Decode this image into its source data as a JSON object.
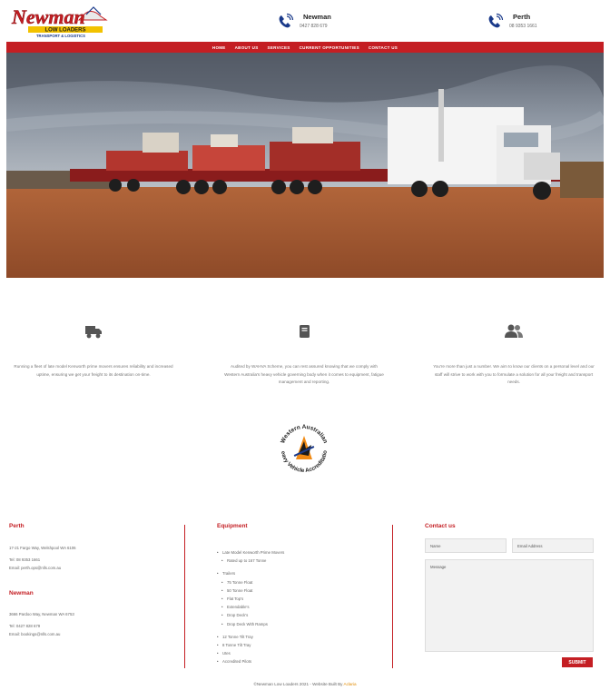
{
  "header": {
    "logo_text": "Newman",
    "logo_subtext": "LOW LOADERS",
    "logo_tagline": "TRANSPORT & LOGISTICS",
    "contacts": [
      {
        "name": "Newman",
        "phone": "0427 828 679"
      },
      {
        "name": "Perth",
        "phone": "08 9353 1661"
      }
    ]
  },
  "nav": {
    "items": [
      "HOME",
      "ABOUT US",
      "SERVICES",
      "CURRENT OPPORTUNITIES",
      "CONTACT US"
    ]
  },
  "features": [
    {
      "icon": "truck-icon",
      "text": "Running a fleet of late model Kenworth prime movers ensures reliability and increased uptime, ensuring we get your freight to its destination on-time."
    },
    {
      "icon": "book-icon",
      "text": "Audited by WAHVA Scheme, you can rest assured knowing that we comply with Western Australia's heavy vehicle governing body when it comes to equipment, fatigue management and reporting."
    },
    {
      "icon": "users-icon",
      "text": "You're more than just a number. We aim to know our clients on a personal level and our staff will strive to work with you to formulate a solution for all your freight and transport needs."
    }
  ],
  "accreditation": {
    "top_text": "Western Australian",
    "bottom_text": "Heavy Vehicle Accreditation"
  },
  "footer": {
    "perth": {
      "title": "Perth",
      "address": "17-21 Fargo Way, Welshpool WA 6106",
      "tel": "Tel: 08 9353 1661",
      "email": "Email: perth.ops@nlls.com.au"
    },
    "newman": {
      "title": "Newman",
      "address": "3666 Pardoo Way, Newman WA 6753",
      "tel": "Tel: 0427 828 679",
      "email": "Email: bookings@nlls.com.au"
    },
    "equipment": {
      "title": "Equipment",
      "items": [
        {
          "label": "Late Model Kenworth Prime Movers",
          "level": 0,
          "gap": false
        },
        {
          "label": "Rated up to 167 Tonne",
          "level": 1,
          "gap": false
        },
        {
          "label": "Trailers",
          "level": 0,
          "gap": true
        },
        {
          "label": "75 Tonne Float",
          "level": 1,
          "gap": false
        },
        {
          "label": "50 Tonne Float",
          "level": 1,
          "gap": false
        },
        {
          "label": "Flat Top's",
          "level": 1,
          "gap": false
        },
        {
          "label": "Extendable's",
          "level": 1,
          "gap": false
        },
        {
          "label": "Drop Deck's",
          "level": 1,
          "gap": false
        },
        {
          "label": "Drop Deck With Ramps",
          "level": 1,
          "gap": false
        },
        {
          "label": "12 Tonne Tilt Tray",
          "level": 0,
          "gap": true
        },
        {
          "label": "8 Tonne Tilt Tray",
          "level": 0,
          "gap": false
        },
        {
          "label": "Utes",
          "level": 0,
          "gap": false
        },
        {
          "label": "Accredited Pilots",
          "level": 0,
          "gap": false
        }
      ]
    },
    "contact": {
      "title": "Contact us",
      "name_placeholder": "Name",
      "email_placeholder": "Email Address",
      "message_placeholder": "Message",
      "submit_label": "SUBMIT"
    }
  },
  "copyright": {
    "text": "©Newman Low Loaders 2021 - Website Built By ",
    "credit": "Aclaria"
  },
  "colors": {
    "brand_red": "#c41e23",
    "credit_orange": "#e08a00"
  }
}
